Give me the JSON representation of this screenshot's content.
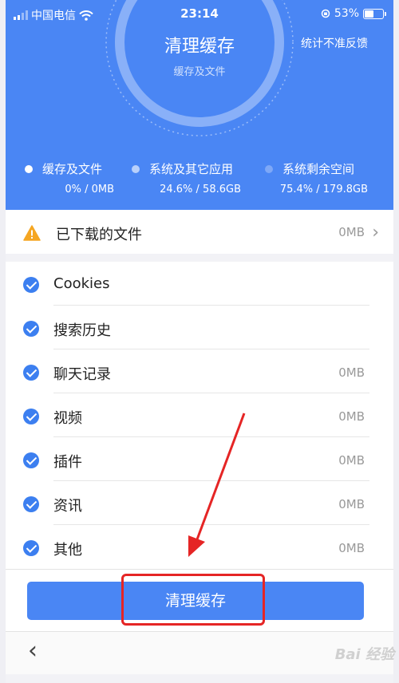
{
  "status_bar": {
    "carrier": "中国电信",
    "time": "23:14",
    "battery": "53%"
  },
  "header": {
    "title": "清理缓存",
    "feedback": "统计不准反馈",
    "arc_label": "缓存及文件",
    "legend": [
      {
        "label": "缓存及文件",
        "value": "0% / 0MB",
        "color": "#ffffff"
      },
      {
        "label": "系统及其它应用",
        "value": "24.6% / 58.6GB",
        "color": "#b8d0fb"
      },
      {
        "label": "系统剩余空间",
        "value": "75.4% / 179.8GB",
        "color": "#7ea8f7"
      }
    ]
  },
  "downloads": {
    "label": "已下载的文件",
    "size": "0MB"
  },
  "items": [
    {
      "label": "Cookies",
      "size": ""
    },
    {
      "label": "搜索历史",
      "size": ""
    },
    {
      "label": "聊天记录",
      "size": "0MB"
    },
    {
      "label": "视频",
      "size": "0MB"
    },
    {
      "label": "插件",
      "size": "0MB"
    },
    {
      "label": "资讯",
      "size": "0MB"
    },
    {
      "label": "其他",
      "size": "0MB"
    }
  ],
  "clean_button": {
    "label": "清理缓存"
  },
  "nav": {
    "back_icon": "chevron-left-icon"
  },
  "watermark": "Bai 经验"
}
